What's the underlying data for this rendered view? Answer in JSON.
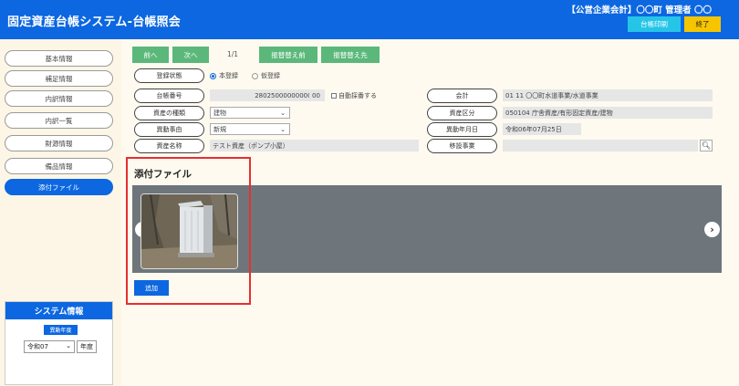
{
  "header": {
    "title": "固定資産台帳システム-台帳照会",
    "user_info": "【公営企業会計】〇〇町 管理者 〇〇",
    "print_button": "台帳印刷",
    "exit_button": "終了",
    "colors": {
      "primary": "#0c67e0",
      "print": "#26c5e8",
      "exit": "#f5c600"
    }
  },
  "sidebar": {
    "items": [
      {
        "label": "基本情報",
        "active": false
      },
      {
        "label": "補足情報",
        "active": false
      },
      {
        "label": "内訳情報",
        "active": false
      },
      {
        "label": "内訳一覧",
        "active": false
      },
      {
        "label": "財源情報",
        "active": false
      },
      {
        "label": "備品情報",
        "active": false
      },
      {
        "label": "添付ファイル",
        "active": true
      }
    ]
  },
  "system_info": {
    "title": "システム情報",
    "subtitle": "異動年度",
    "year_value": "令和07",
    "year_unit": "年度"
  },
  "toolbar": {
    "prev": "前へ",
    "next": "次へ",
    "pager": "1/1",
    "before_change": "振替替え前",
    "after_change": "振替替え先"
  },
  "form": {
    "registration_status": {
      "label": "登録状態",
      "options": [
        {
          "label": "本登録",
          "selected": true
        },
        {
          "label": "仮登録",
          "selected": false
        }
      ]
    },
    "ledger_number": {
      "label": "台帳番号",
      "value": "2802500000000033-",
      "suffix": "00",
      "checkbox_label": "自動採番する"
    },
    "asset_type": {
      "label": "資産の種類",
      "value": "建物"
    },
    "change_reason": {
      "label": "異動事由",
      "value": "新規"
    },
    "asset_name": {
      "label": "資産名称",
      "value": "テスト資産（ポンプ小屋）"
    },
    "accounting": {
      "label": "会計",
      "value": "01  11  〇〇町水道事業/水道事業"
    },
    "asset_category": {
      "label": "資産区分",
      "value": "050104 庁舎資産/有形固定資産/建物"
    },
    "change_date": {
      "label": "異動年月日",
      "value": "令和06年07月25日"
    },
    "transfer_item": {
      "label": "移設事業",
      "value": ""
    }
  },
  "attachments": {
    "title": "添付ファイル",
    "add_button": "追加"
  }
}
